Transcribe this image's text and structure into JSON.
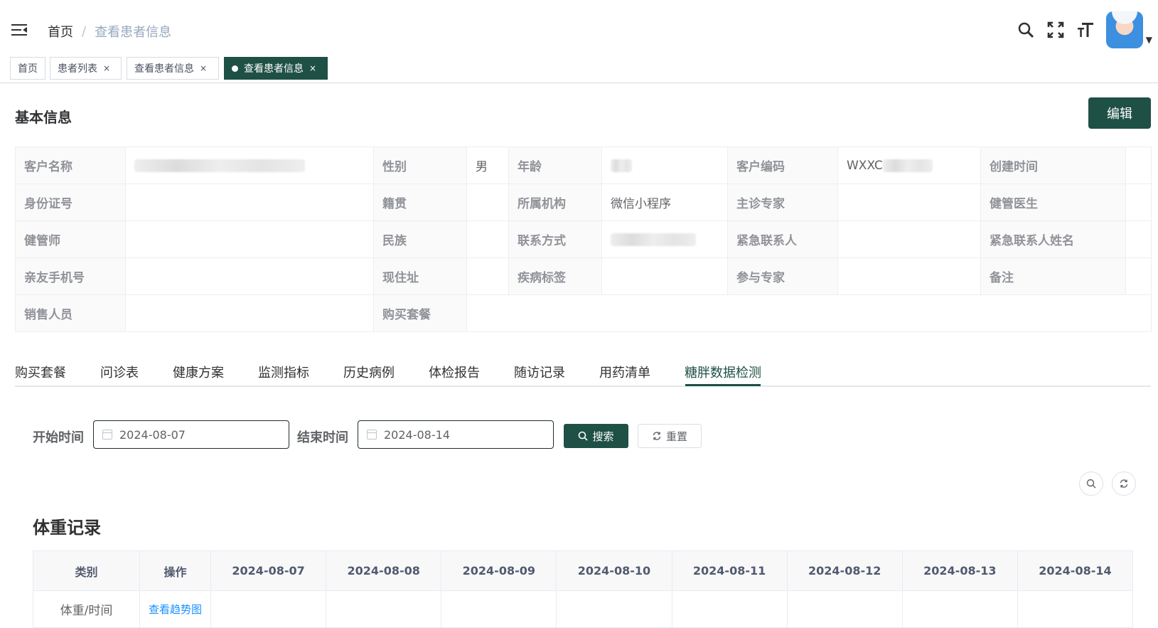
{
  "navbar": {
    "breadcrumb": [
      "首页",
      "查看患者信息"
    ],
    "breadcrumb_sep": "/"
  },
  "tags": [
    {
      "label": "首页"
    },
    {
      "label": "患者列表",
      "close": "×"
    },
    {
      "label": "查看患者信息",
      "close": "×"
    },
    {
      "label": "查看患者信息",
      "close": "×",
      "active": true
    }
  ],
  "basic_info": {
    "title": "基本信息",
    "edit_label": "编辑",
    "labels": {
      "customer_name": "客户名称",
      "gender": "性别",
      "age": "年龄",
      "customer_code": "客户编码",
      "created_time": "创建时间",
      "id_number": "身份证号",
      "native_place": "籍贯",
      "institution": "所属机构",
      "chief_expert": "主诊专家",
      "health_doctor": "健管医生",
      "health_manager": "健管师",
      "ethnicity": "民族",
      "contact": "联系方式",
      "emergency_contact": "紧急联系人",
      "emergency_contact_name": "紧急联系人姓名",
      "relative_phone": "亲友手机号",
      "address": "现住址",
      "disease_tag": "疾病标签",
      "participating_expert": "参与专家",
      "remark": "备注",
      "salesperson": "销售人员",
      "purchased_package": "购买套餐"
    },
    "values": {
      "gender": "男",
      "customer_code_prefix": "WXXC",
      "institution": "微信小程序"
    }
  },
  "tabs": [
    "购买套餐",
    "问诊表",
    "健康方案",
    "监测指标",
    "历史病例",
    "体检报告",
    "随访记录",
    "用药清单",
    "糖胖数据检测"
  ],
  "active_tab": "糖胖数据检测",
  "search": {
    "start_label": "开始时间",
    "start_value": "2024-08-07",
    "end_label": "结束时间",
    "end_value": "2024-08-14",
    "search_button": "搜索",
    "reset_button": "重置"
  },
  "weight": {
    "title": "体重记录",
    "headers": [
      "类别",
      "操作",
      "2024-08-07",
      "2024-08-08",
      "2024-08-09",
      "2024-08-10",
      "2024-08-11",
      "2024-08-12",
      "2024-08-13",
      "2024-08-14"
    ],
    "row": {
      "category": "体重/时间",
      "action": "查看趋势图"
    }
  },
  "colors": {
    "primary": "#1f5045",
    "link": "#1890ff"
  }
}
